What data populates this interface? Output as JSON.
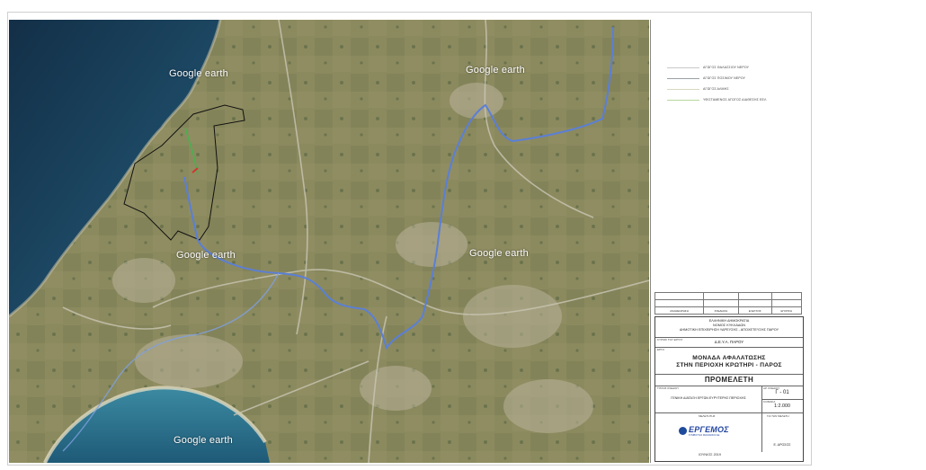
{
  "map": {
    "watermarks": [
      "Google earth",
      "Google earth",
      "Google earth",
      "Google earth",
      "Google earth"
    ],
    "colors": {
      "sea_deep": "#173a54",
      "sea_shallow": "#2c6d88",
      "land": "#8a8a5e",
      "pipeline": "#5b7fd6",
      "plot_outline": "#111111",
      "proposed_route_green": "#4caf50",
      "proposed_route_red": "#d9302c"
    }
  },
  "legend": {
    "items": [
      {
        "label": "ΑΓΩΓΟΣ ΘΑΛΑΣΣΙΟΥ ΝΕΡΟΥ",
        "color": "#c8c8c8"
      },
      {
        "label": "ΑΓΩΓΟΣ ΠΟΣΙΜΟΥ ΝΕΡΟΥ",
        "color": "#9aa0a6"
      },
      {
        "label": "ΑΓΩΓΟΣ ΑΛΜΗΣ",
        "color": "#d9d9c0"
      },
      {
        "label": "ΥΦΙΣΤΑΜΕΝΟΣ ΑΓΩΓΟΣ ΔΙΑΘΕΣΗΣ ΕΕΛ",
        "color": "#b7d89a"
      }
    ]
  },
  "revisions": {
    "headers": [
      "ΑΝΑΘΕΩΡΗΣΗ",
      "ΣΧΕΔΙΑΣΗ",
      "ΕΛΕΓΧΟΣ",
      "ΕΓΚΡΙΣΗ"
    ]
  },
  "title_block": {
    "authority": [
      "ΕΛΛΗΝΙΚΗ ΔΗΜΟΚΡΑΤΙΑ",
      "ΝΟΜΟΣ ΚΥΚΛΑΔΩΝ",
      "ΔΗΜΟΤΙΚΗ ΕΠΙΧΕΙΡΗΣΗ ΥΔΡΕΥΣΗΣ - ΑΠΟΧΕΤΕΥΣΗΣ ΠΑΡΟΥ"
    ],
    "owner_label": "ΚΥΡΙΟΣ ΤΟΥ ΕΡΓΟΥ",
    "owner": "Δ.Ε.Υ.Α. ΠΑΡΟΥ",
    "project_label": "ΕΡΓΟ",
    "project_line1": "ΜΟΝΑΔΑ ΑΦΑΛΑΤΩΣΗΣ",
    "project_line2": "ΣΤΗΝ ΠΕΡΙΟΧΗ ΚΡΩΤΗΡΙ - ΠΑΡΟΣ",
    "study": "ΠΡΟΜΕΛΕΤΗ",
    "drawing_title_label": "ΤΙΤΛΟΣ ΣΧΕΔΙΟΥ",
    "drawing_title": "ΓΕΝΙΚΗ ΔΙΑΤΑΞΗ ΕΡΓΩΝ ΕΥΡΥΤΕΡΗΣ ΠΕΡΙΟΧΗΣ",
    "drawing_no_label": "ΑΡ. ΣΧΕΔΙΟΥ",
    "drawing_no": "Γ - 01",
    "scale_label": "ΚΛΙΜΑΚΑ",
    "scale": "1:2.000",
    "consultant_label": "ΜΕΛΕΤΗΤΗΣ",
    "consultant_logo": "ΕΡΓΕΜΟΣ",
    "consultant_sub": "ΣΥΜΒΟΥΛΟΙ ΜΗΧΑΝΙΚΟΙ ΑΕ",
    "plot_label": "ΓΙΑ ΤΗΝ ΜΕΛΕΤΗ",
    "signature": "Ε. ΔΡΟΣΟΣ",
    "date": "ΙΟΥΝΙΟΣ 2019"
  }
}
